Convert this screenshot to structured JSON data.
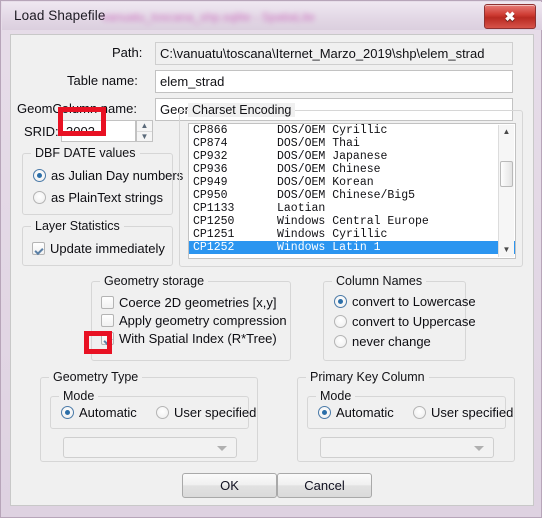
{
  "window": {
    "title": "Load Shapefile",
    "title_redacted_text": "vanuatu_toscana_shp.sqlite  -  SpatiaLite",
    "close_label": "✖"
  },
  "form": {
    "path": {
      "label": "Path:",
      "value": "C:\\vanuatu\\toscana\\Iternet_Marzo_2019\\shp\\elem_strad"
    },
    "table_name": {
      "label": "Table name:",
      "value": "elem_strad"
    },
    "geom_column": {
      "label": "GeomColumn name:",
      "value": "Geometry"
    },
    "srid": {
      "label": "SRID:",
      "value": "3003",
      "spin_up": "▲",
      "spin_down": "▼"
    }
  },
  "dbf_date": {
    "caption": "DBF DATE values",
    "options": [
      {
        "label": "as Julian Day numbers",
        "selected": true
      },
      {
        "label": "as PlainText strings",
        "selected": false
      }
    ]
  },
  "layer_statistics": {
    "caption": "Layer Statistics",
    "checkbox": {
      "label": "Update immediately",
      "checked": true
    }
  },
  "charset": {
    "caption": "Charset Encoding",
    "rows": [
      {
        "code": "CP866",
        "name": "DOS/OEM Cyrillic",
        "selected": false
      },
      {
        "code": "CP874",
        "name": "DOS/OEM Thai",
        "selected": false
      },
      {
        "code": "CP932",
        "name": "DOS/OEM Japanese",
        "selected": false
      },
      {
        "code": "CP936",
        "name": "DOS/OEM Chinese",
        "selected": false
      },
      {
        "code": "CP949",
        "name": "DOS/OEM Korean",
        "selected": false
      },
      {
        "code": "CP950",
        "name": "DOS/OEM Chinese/Big5",
        "selected": false
      },
      {
        "code": "CP1133",
        "name": "Laotian",
        "selected": false
      },
      {
        "code": "CP1250",
        "name": "Windows Central Europe",
        "selected": false
      },
      {
        "code": "CP1251",
        "name": "Windows Cyrillic",
        "selected": false
      },
      {
        "code": "CP1252",
        "name": "Windows Latin 1",
        "selected": true
      }
    ],
    "scroll_up": "▲",
    "scroll_down": "▼"
  },
  "geometry_storage": {
    "caption": "Geometry storage",
    "checkboxes": [
      {
        "label": "Coerce 2D geometries [x,y]",
        "checked": false
      },
      {
        "label": "Apply geometry compression",
        "checked": false
      },
      {
        "label": "With Spatial Index (R*Tree)",
        "checked": true
      }
    ]
  },
  "column_names": {
    "caption": "Column Names",
    "options": [
      {
        "label": "convert to Lowercase",
        "selected": true
      },
      {
        "label": "convert to Uppercase",
        "selected": false
      },
      {
        "label": "never change",
        "selected": false
      }
    ]
  },
  "geometry_type": {
    "caption": "Geometry Type",
    "mode_caption": "Mode",
    "options": [
      {
        "label": "Automatic",
        "selected": true
      },
      {
        "label": "User specified",
        "selected": false
      }
    ],
    "combo_value": ""
  },
  "primary_key_column": {
    "caption": "Primary Key Column",
    "mode_caption": "Mode",
    "options": [
      {
        "label": "Automatic",
        "selected": true
      },
      {
        "label": "User specified",
        "selected": false
      }
    ],
    "combo_value": ""
  },
  "buttons": {
    "ok": "OK",
    "cancel": "Cancel"
  },
  "annotations": {
    "highlight_color": "#e81123",
    "boxes": [
      {
        "target": "srid-value-field"
      },
      {
        "target": "spatial-index-checkbox"
      }
    ]
  }
}
